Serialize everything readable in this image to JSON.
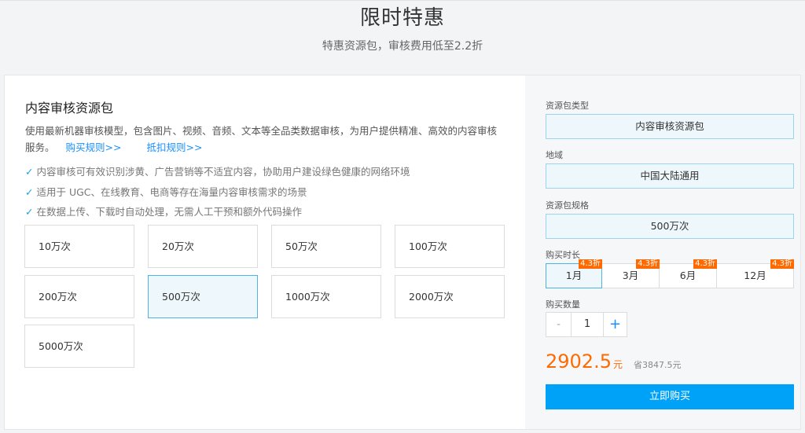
{
  "header": {
    "title": "限时特惠",
    "subtitle": "特惠资源包，审核费用低至2.2折"
  },
  "product": {
    "title": "内容审核资源包",
    "description": "使用最新机器审核模型，包含图片、视频、音频、文本等全品类数据审核，为用户提供精准、高效的内容审核服务。",
    "buy_rules_link": "购买规则>>",
    "deduct_rules_link": "抵扣规则>>",
    "features": [
      "内容审核可有效识别涉黄、广告营销等不适宜内容，协助用户建设绿色健康的网络环境",
      "适用于 UGC、在线教育、电商等存在海量内容审核需求的场景",
      "在数据上传、下载时自动处理，无需人工干预和额外代码操作"
    ],
    "specs": [
      "10万次",
      "20万次",
      "50万次",
      "100万次",
      "200万次",
      "500万次",
      "1000万次",
      "2000万次",
      "5000万次"
    ],
    "selected_spec": "500万次"
  },
  "order": {
    "type_label": "资源包类型",
    "type_value": "内容审核资源包",
    "region_label": "地域",
    "region_value": "中国大陆通用",
    "spec_label": "资源包规格",
    "spec_value": "500万次",
    "duration_label": "购买时长",
    "durations": [
      {
        "label": "1月",
        "tag": "4.3折"
      },
      {
        "label": "3月",
        "tag": "4.3折"
      },
      {
        "label": "6月",
        "tag": "4.3折"
      },
      {
        "label": "12月",
        "tag": "4.3折"
      }
    ],
    "selected_duration": "1月",
    "quantity_label": "购买数量",
    "quantity": "1",
    "minus_symbol": "-",
    "plus_symbol": "+",
    "price": "2902.5",
    "price_unit": "元",
    "savings": "省3847.5元",
    "buy_button": "立即购买"
  },
  "colors": {
    "accent": "#00a2f8",
    "price": "#ff6a00",
    "selected_bg": "#eef8fc",
    "selected_border": "#4db3e6"
  }
}
